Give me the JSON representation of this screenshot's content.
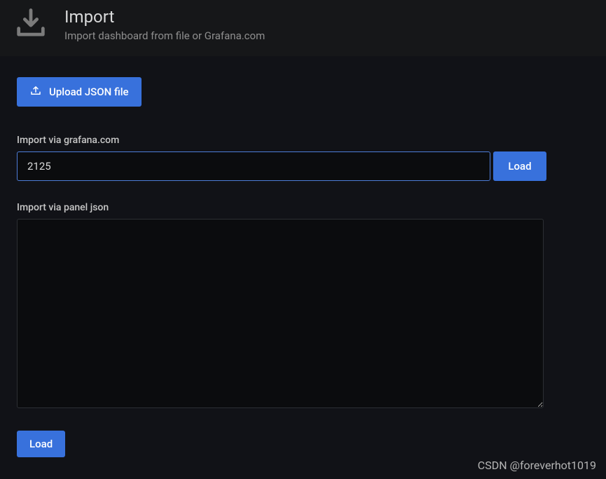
{
  "header": {
    "title": "Import",
    "subtitle": "Import dashboard from file or Grafana.com"
  },
  "upload_button": {
    "label": "Upload JSON file"
  },
  "grafana_section": {
    "label": "Import via grafana.com",
    "value": "2125",
    "load_label": "Load"
  },
  "panel_json_section": {
    "label": "Import via panel json",
    "value": ""
  },
  "bottom_load_label": "Load",
  "watermark": "CSDN @foreverhot1019"
}
